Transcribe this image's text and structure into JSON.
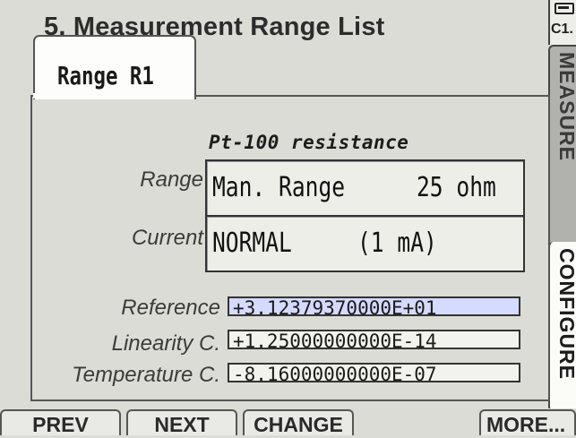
{
  "header": {
    "title": "5. Measurement Range List"
  },
  "status": {
    "battery_icon": "battery-icon",
    "channel": "C1."
  },
  "side_tabs": {
    "measure": "MEASURE",
    "configure": "CONFIGURE"
  },
  "range_tab": {
    "label": "Range R1"
  },
  "sensor_type": "Pt-100 resistance",
  "fields": {
    "range": {
      "label": "Range",
      "mode": "Man. Range",
      "value": "25 ohm"
    },
    "current": {
      "label": "Current",
      "mode": "NORMAL",
      "value": "(1 mA)"
    },
    "reference": {
      "label": "Reference",
      "value": "+3.12379370000E+01"
    },
    "linearity": {
      "label": "Linearity C.",
      "value": "+1.25000000000E-14"
    },
    "temperature": {
      "label": "Temperature C.",
      "value": "-8.16000000000E-07"
    }
  },
  "softkeys": {
    "prev": "PREV",
    "next": "NEXT",
    "change": "CHANGE",
    "more": "MORE..."
  },
  "colors": {
    "background": "#dbdcd5",
    "selected_field": "#d5daff"
  }
}
